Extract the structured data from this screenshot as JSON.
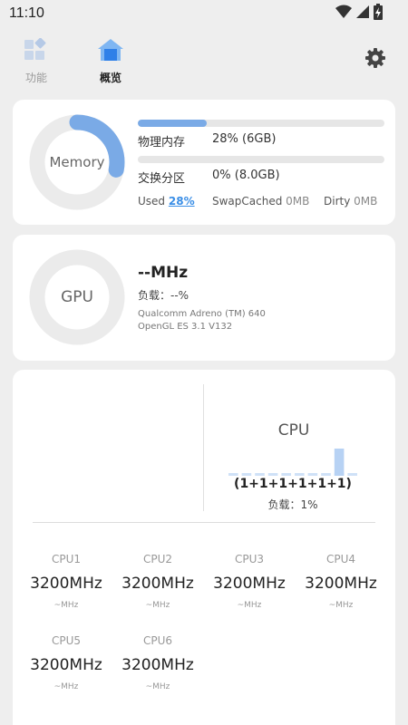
{
  "status_bar": {
    "time": "11:10"
  },
  "nav": {
    "tabs": [
      {
        "label": "功能",
        "active": false
      },
      {
        "label": "概览",
        "active": true
      }
    ]
  },
  "memory": {
    "ring_label": "Memory",
    "usage_fraction": 0.28,
    "physical": {
      "label": "物理内存",
      "value": "28% (6GB)",
      "fraction": 0.28
    },
    "swap": {
      "label": "交换分区",
      "value": "0% (8.0GB)",
      "fraction": 0.0
    },
    "used_label": "Used",
    "used_value": "28%",
    "swapcached_label": "SwapCached",
    "swapcached_value": "0MB",
    "dirty_label": "Dirty",
    "dirty_value": "0MB"
  },
  "gpu": {
    "ring_label": "GPU",
    "freq": "--MHz",
    "load": "负载：--%",
    "renderer": "Qualcomm Adreno (TM) 640",
    "gl_version": "OpenGL ES 3.1 V132"
  },
  "cpu": {
    "title": "CPU",
    "cores_summary": "(1+1+1+1+1+1)",
    "load": "负载：1%",
    "core_loads": [
      0,
      0,
      0,
      0,
      0,
      0,
      0,
      0,
      1.0,
      0
    ],
    "cores": [
      {
        "name": "CPU1",
        "freq": "3200MHz",
        "sub": "~MHz"
      },
      {
        "name": "CPU2",
        "freq": "3200MHz",
        "sub": "~MHz"
      },
      {
        "name": "CPU3",
        "freq": "3200MHz",
        "sub": "~MHz"
      },
      {
        "name": "CPU4",
        "freq": "3200MHz",
        "sub": "~MHz"
      },
      {
        "name": "CPU5",
        "freq": "3200MHz",
        "sub": "~MHz"
      },
      {
        "name": "CPU6",
        "freq": "3200MHz",
        "sub": "~MHz"
      }
    ]
  },
  "colors": {
    "accent": "#7aaae6",
    "link": "#3a8ee6",
    "ring_track": "#ebebeb",
    "background": "#eeeeee"
  }
}
